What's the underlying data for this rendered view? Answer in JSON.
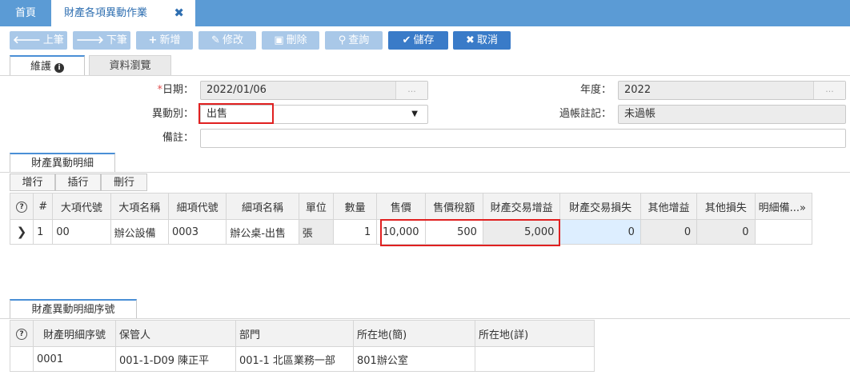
{
  "top_tabs": {
    "home": "首頁",
    "active": "財產各項異動作業",
    "close": "✖"
  },
  "toolbar": {
    "prev": "上筆",
    "next": "下筆",
    "add": "新增",
    "edit": "修改",
    "delete": "刪除",
    "query": "查詢",
    "save": "儲存",
    "cancel": "取消"
  },
  "icons": {
    "prev": "arrow-left-icon",
    "next": "arrow-right-icon",
    "add": "plus-icon",
    "edit": "pencil-icon",
    "delete": "trash-icon",
    "query": "search-icon",
    "save": "check-icon",
    "cancel": "x-icon"
  },
  "form_tabs": {
    "maintain": "維護",
    "browse": "資料瀏覽"
  },
  "form": {
    "date_label_star": "*",
    "date_label": "日期：",
    "date_value": "2022/01/06",
    "year_label": "年度：",
    "year_value": "2022",
    "change_type_label": "異動別：",
    "change_type_value": "出售",
    "posting_label": "過帳註記：",
    "posting_value": "未過帳",
    "remark_label": "備註：",
    "remark_value": "",
    "ellipsis": "..."
  },
  "detail": {
    "tab": "財產異動明細",
    "buttons": {
      "add_row": "增行",
      "insert_row": "插行",
      "delete_row": "刪行"
    },
    "columns": [
      "#",
      "大項代號",
      "大項名稱",
      "細項代號",
      "細項名稱",
      "單位",
      "數量",
      "售價",
      "售價稅額",
      "財產交易增益",
      "財產交易損失",
      "其他增益",
      "其他損失",
      "明細備..."
    ],
    "rows": [
      {
        "no": "1",
        "major_code": "00",
        "major_name": "辦公設備",
        "minor_code": "0003",
        "minor_name": "辦公桌-出售",
        "unit": "張",
        "qty": "1",
        "price": "10,000",
        "tax": "500",
        "gain": "5,000",
        "loss": "0",
        "other_gain": "0",
        "other_loss": "0",
        "note": ""
      }
    ],
    "row_pointer": "❯",
    "more": "»"
  },
  "serial": {
    "tab": "財產異動明細序號",
    "columns": [
      "財產明細序號",
      "保管人",
      "部門",
      "所在地(簡)",
      "所在地(詳)"
    ],
    "rows": [
      {
        "serial_no": "0001",
        "custodian": "001-1-D09 陳正平",
        "dept": "001-1 北區業務一部",
        "loc_short": "801辦公室",
        "loc_detail": ""
      }
    ]
  },
  "colors": {
    "topbar": "#5b9bd5",
    "button_enabled": "#3a7bc8",
    "button_disabled": "#a9c8e8",
    "highlight_box": "#e02020"
  }
}
